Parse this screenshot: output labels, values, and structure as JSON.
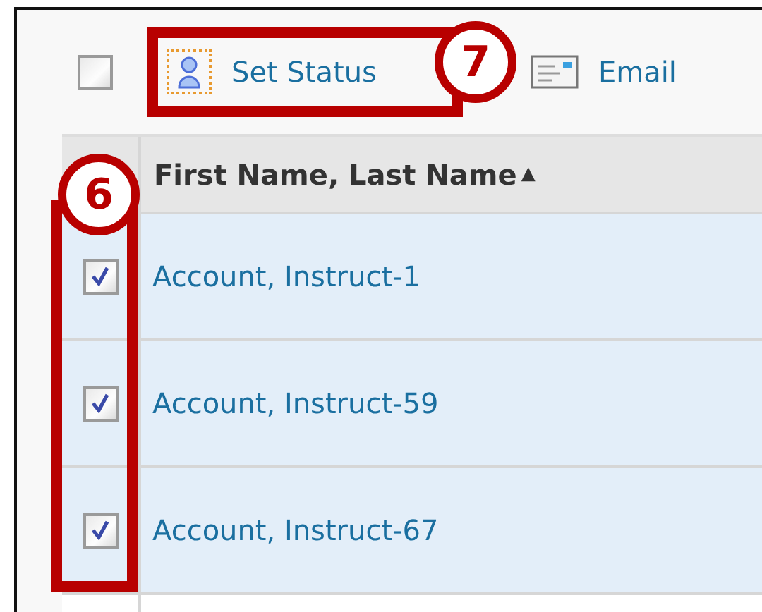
{
  "toolbar": {
    "select_all": {
      "checked": false
    },
    "actions": [
      {
        "kind": "status",
        "label": "Set Status"
      },
      {
        "kind": "email",
        "label": "Email"
      }
    ]
  },
  "table": {
    "columns": [
      {
        "label": "First Name, Last Name",
        "sort_indicator": "▲"
      }
    ],
    "rows": [
      {
        "name": "Account, Instruct-1",
        "checked": true
      },
      {
        "name": "Account, Instruct-59",
        "checked": true
      },
      {
        "name": "Account, Instruct-67",
        "checked": true
      }
    ]
  },
  "callouts": [
    {
      "number": "7",
      "kind": "action"
    },
    {
      "number": "6",
      "kind": "column"
    }
  ]
}
